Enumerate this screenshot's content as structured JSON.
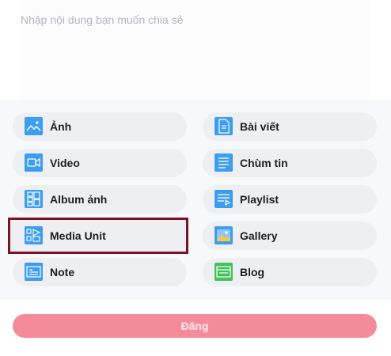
{
  "compose": {
    "placeholder": "Nhập nội dung bạn muốn chia sẻ"
  },
  "options": {
    "left": [
      {
        "label": "Ảnh",
        "icon": "image-icon"
      },
      {
        "label": "Video",
        "icon": "video-icon"
      },
      {
        "label": "Album ảnh",
        "icon": "album-icon"
      },
      {
        "label": "Media Unit",
        "icon": "media-unit-icon"
      },
      {
        "label": "Note",
        "icon": "note-icon"
      }
    ],
    "right": [
      {
        "label": "Bài viết",
        "icon": "article-icon"
      },
      {
        "label": "Chùm tin",
        "icon": "news-cluster-icon"
      },
      {
        "label": "Playlist",
        "icon": "playlist-icon"
      },
      {
        "label": "Gallery",
        "icon": "gallery-icon"
      },
      {
        "label": "Blog",
        "icon": "blog-icon"
      }
    ]
  },
  "footer": {
    "post_label": "Đăng"
  },
  "colors": {
    "icon_blue": "#3d9df0",
    "icon_green": "#44c15a",
    "focus_outline": "#7a1327",
    "post_button": "#f48b9b"
  }
}
